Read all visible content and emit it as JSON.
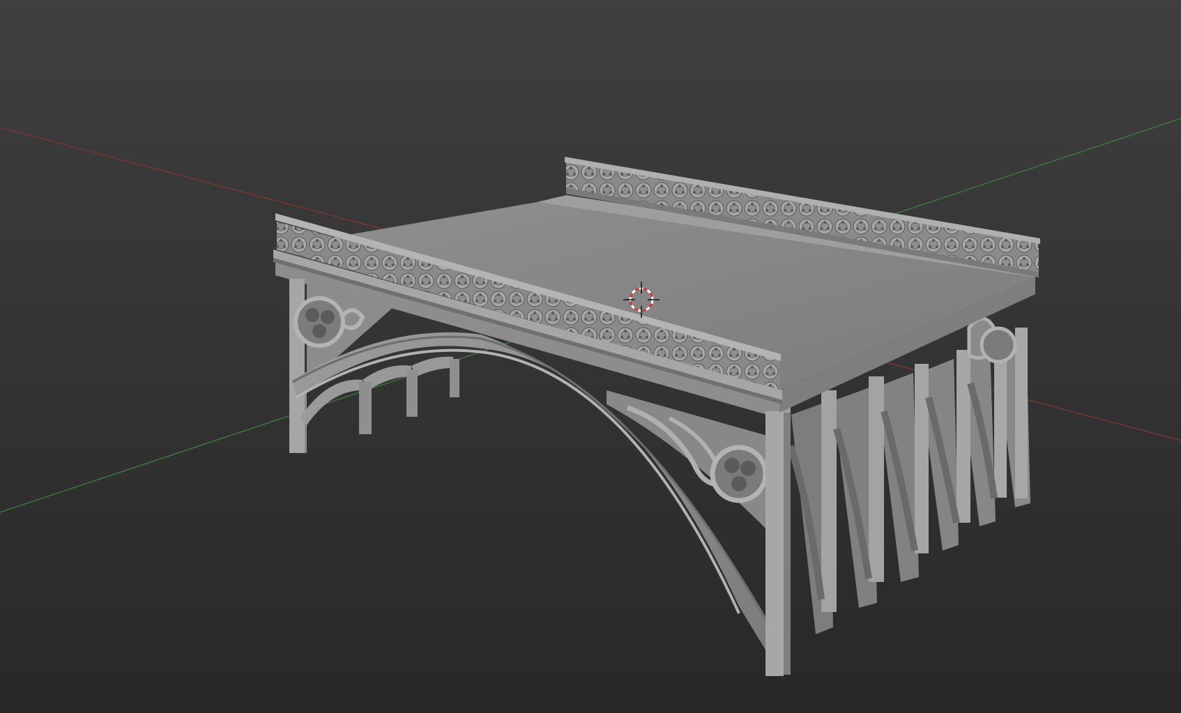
{
  "viewport": {
    "mode": "3d-viewport-solid-shading",
    "background_top": "#3d3d3d",
    "background_bottom": "#2a2a2a"
  },
  "axes": {
    "x_axis_color": "#8b3a3a",
    "y_axis_color": "#3f8a3f"
  },
  "model": {
    "object": "ornate-arch-bridge",
    "surface_color": "#9a9a9a",
    "shadow_color": "#6e6e6e",
    "highlight_color": "#b4b4b4"
  },
  "cursor": {
    "icon": "3d-cursor-icon",
    "ring_color_a": "#d23a3a",
    "ring_color_b": "#ffffff"
  }
}
